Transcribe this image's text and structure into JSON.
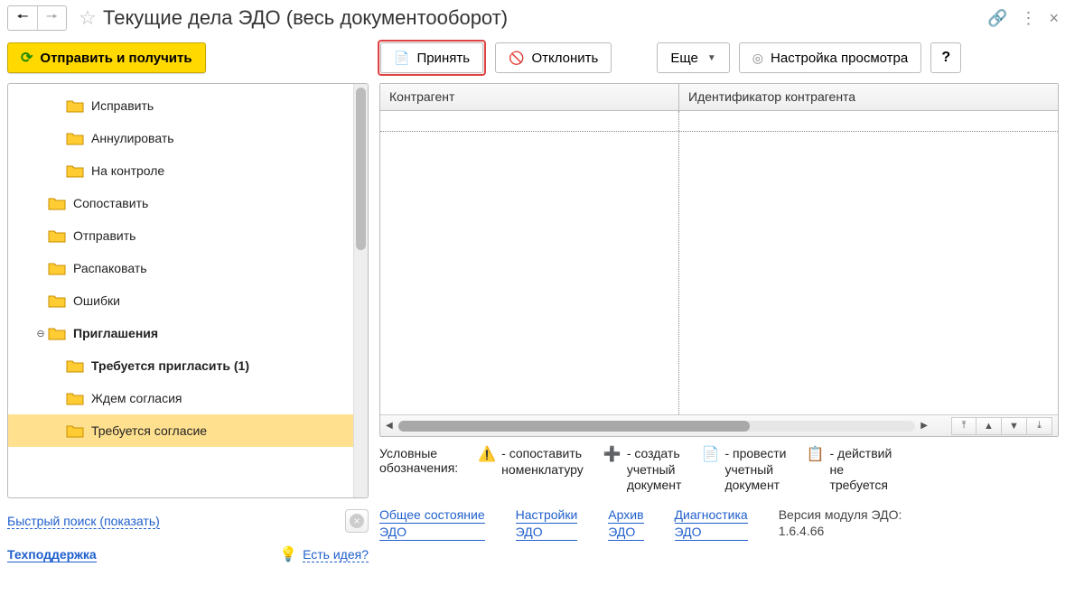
{
  "title": "Текущие дела ЭДО (весь документооборот)",
  "title_icons": {
    "link": "🔗",
    "menu": "⋮",
    "close": "×"
  },
  "buttons": {
    "send_receive": "Отправить и получить",
    "accept": "Принять",
    "reject": "Отклонить",
    "more": "Еще",
    "view_settings": "Настройка просмотра",
    "help": "?"
  },
  "tree": {
    "items": [
      {
        "label": "Исправить",
        "indent": "indent-2b",
        "selected": false
      },
      {
        "label": "Аннулировать",
        "indent": "indent-2b",
        "selected": false
      },
      {
        "label": "На контроле",
        "indent": "indent-2b",
        "selected": false
      },
      {
        "label": "Сопоставить",
        "indent": "indent-1",
        "selected": false
      },
      {
        "label": "Отправить",
        "indent": "indent-1",
        "selected": false
      },
      {
        "label": "Распаковать",
        "indent": "indent-1",
        "selected": false
      },
      {
        "label": "Ошибки",
        "indent": "indent-1",
        "selected": false
      },
      {
        "label": "Приглашения",
        "indent": "indent-1",
        "bold": true,
        "expander": "⊖",
        "selected": false
      },
      {
        "label": "Требуется пригласить (1)",
        "indent": "indent-3",
        "bold": true,
        "selected": false
      },
      {
        "label": "Ждем согласия",
        "indent": "indent-3",
        "selected": false
      },
      {
        "label": "Требуется согласие",
        "indent": "indent-3",
        "selected": true
      }
    ]
  },
  "quick_search": "Быстрый поиск (показать)",
  "tech_support": "Техподдержка",
  "idea_link": "Есть идея?",
  "grid": {
    "columns": {
      "a": "Контрагент",
      "b": "Идентификатор контрагента"
    }
  },
  "legend": {
    "label": "Условные\nобозначения:",
    "items": [
      {
        "icon": "⚠️",
        "text": "- сопоставить\nноменклатуру"
      },
      {
        "icon": "➕",
        "text": "- создать\nучетный\nдокумент",
        "color": "#2aa52a"
      },
      {
        "icon": "📄",
        "text": "- провести\nучетный\nдокумент",
        "color": "#2aa52a"
      },
      {
        "icon": "📋",
        "text": "- действий\nне\nтребуется",
        "color": "#7a7a7a"
      }
    ]
  },
  "bottom": {
    "links": [
      {
        "l1": "Общее состояние",
        "l2": "ЭДО"
      },
      {
        "l1": "Настройки",
        "l2": "ЭДО"
      },
      {
        "l1": "Архив",
        "l2": "ЭДО"
      },
      {
        "l1": "Диагностика",
        "l2": "ЭДО"
      }
    ],
    "version_label": "Версия модуля ЭДО:",
    "version_value": "1.6.4.66"
  }
}
